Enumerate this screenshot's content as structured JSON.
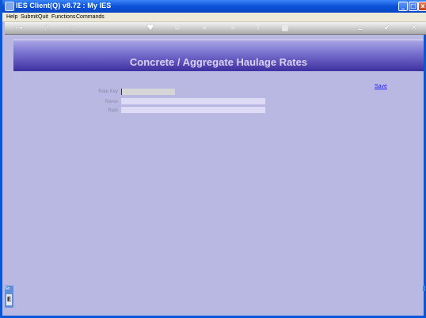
{
  "window": {
    "title": "IES Client(Q) v8.72 : My IES",
    "min_glyph": "_",
    "max_glyph": "□",
    "close_glyph": "x"
  },
  "menu": {
    "items": [
      "Help",
      "Submit",
      "Quit",
      "Functions",
      "Commands"
    ]
  },
  "toolbar": {
    "icons": [
      "key-icon",
      "help-icon",
      "search-icon",
      "heart-icon",
      "refresh-icon",
      "rewind-icon",
      "forward-icon",
      "text-icon",
      "stop-icon",
      "home-icon",
      "check-icon",
      "close-icon"
    ],
    "glyphs": {
      "key": "⊶",
      "help": "?",
      "search": "⌕",
      "heart": "♥",
      "refresh": "↻",
      "rewind": "«",
      "forward": "»",
      "text": "T",
      "stop": "■",
      "home": "⌂",
      "check": "✔",
      "close": "✕"
    }
  },
  "page": {
    "title": "Concrete / Aggregate Haulage Rates"
  },
  "form": {
    "rate_key_label": "Rate Key",
    "rate_key_value": "",
    "name_label": "Name",
    "name_value": "",
    "rate_label": "Rate",
    "rate_value": ""
  },
  "actions": {
    "save_label": "Save"
  },
  "side_tab": {
    "label": "Se",
    "glyph": "E"
  },
  "colors": {
    "background": "#b9b8e2",
    "banner_dark": "#3e2f9f",
    "link": "#1a1aff"
  }
}
